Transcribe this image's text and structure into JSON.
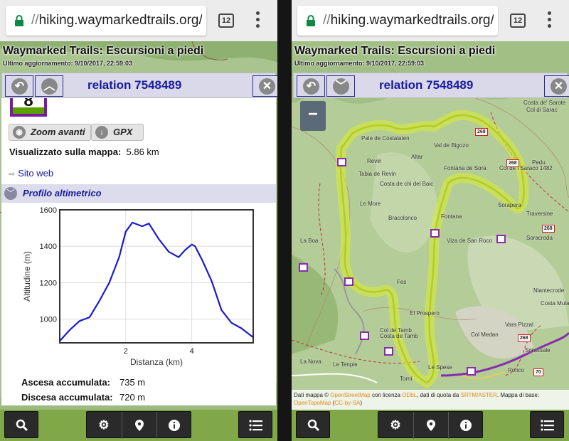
{
  "browser": {
    "url_prefix": "//",
    "url_text": "hiking.waymarkedtrails.org/",
    "url_tail": "#",
    "tab_count": "12"
  },
  "site": {
    "title": "Waymarked Trails: Escursioni a piedi",
    "updated": "Ultimo aggiornamento: 9/10/2017, 22:59:03"
  },
  "sidebar": {
    "title": "relation 7548489"
  },
  "route": {
    "ref": "8",
    "zoom_button": "Zoom avanti",
    "gpx_button": "GPX",
    "visualized_label": "Visualizzato sulla mappa:",
    "visualized_value": "5.86 km",
    "website_link": "Sito web",
    "profile_header": "Profilo altimetrico",
    "ascent_label": "Ascesa accumulata:",
    "ascent_value": "735 m",
    "descent_label": "Discesa accumulata:",
    "descent_value": "720 m"
  },
  "chart_data": {
    "type": "line",
    "xlabel": "Distanza (km)",
    "ylabel": "Altitudine (m)",
    "xlim": [
      0,
      5.86
    ],
    "ylim": [
      870,
      1600
    ],
    "x_ticks": [
      "2",
      "4"
    ],
    "y_ticks": [
      "1000",
      "1200",
      "1400",
      "1600"
    ],
    "color": "#1a1acc",
    "x": [
      0,
      0.3,
      0.6,
      0.9,
      1.2,
      1.5,
      1.8,
      2.0,
      2.2,
      2.5,
      2.7,
      3.0,
      3.3,
      3.6,
      3.8,
      4.0,
      4.1,
      4.3,
      4.6,
      4.9,
      5.2,
      5.5,
      5.86
    ],
    "y": [
      880,
      940,
      990,
      1010,
      1100,
      1200,
      1340,
      1480,
      1530,
      1510,
      1525,
      1440,
      1370,
      1340,
      1380,
      1410,
      1400,
      1330,
      1210,
      1050,
      980,
      950,
      900
    ]
  },
  "right": {
    "zoom_out": "−",
    "attribution_a": "Dati mappa © ",
    "attribution_osm": "OpenStreetMap",
    "attribution_b": " con licenza ",
    "attribution_odbl": "ODbL",
    "attribution_c": ", dati di quota da ",
    "attribution_srtm": "SRTM/ASTER",
    "attribution_d": ". Mappa di base: ",
    "attribution_otm": "OpenTopoMap",
    "attribution_e": " (",
    "attribution_cc": "CC-by-SA",
    "attribution_f": ")",
    "place_labels": [
      "Costa de' Sarote",
      "Col di Sarac",
      "Pale de Costalaten",
      "Val de Bigozo",
      "Col de l Saraco 1482",
      "Pedu",
      "Altar",
      "Revin",
      "Tabia de Revin",
      "Fontana de Sora",
      "Costa de chi del Baic",
      "Le More",
      "Sorapera",
      "Fontana",
      "Bracolonco",
      "Traversine",
      "Viza de San Roco",
      "Soracroda",
      "La Boa",
      "Fes",
      "El Prospero",
      "Niantecrode",
      "Costa Mula",
      "Col de Tamb",
      "Costa de Tamb",
      "Col Medan",
      "Vara Pizzal",
      "La Nova",
      "Le Tenpie",
      "Ronco",
      "Sorassale",
      "Torni",
      "Le Spese"
    ],
    "shields": [
      "268",
      "268",
      "268",
      "268",
      "268",
      "70"
    ]
  },
  "toolbar": {
    "search_icon": "search-icon",
    "settings_icon": "gear-icon",
    "location_icon": "map-pin-icon",
    "info_icon": "info-icon",
    "list_icon": "list-icon"
  }
}
